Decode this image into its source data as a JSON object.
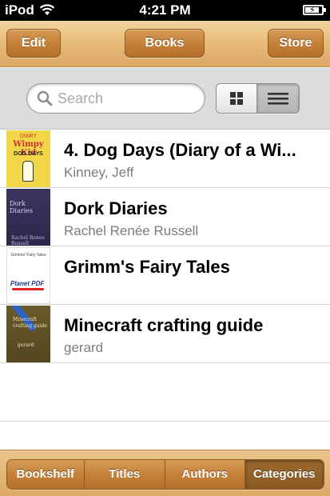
{
  "status_bar": {
    "carrier": "iPod",
    "time": "4:21 PM",
    "wifi_icon": "wifi-icon",
    "battery_icon": "battery-charging-icon"
  },
  "toolbar": {
    "edit_label": "Edit",
    "books_label": "Books",
    "store_label": "Store"
  },
  "search": {
    "placeholder": "Search",
    "value": "",
    "icon": "search-icon"
  },
  "view_toggle": {
    "options": [
      "grid-view-icon",
      "list-view-icon"
    ],
    "selected": "list"
  },
  "books": [
    {
      "title": "4. Dog Days (Diary of a Wi...",
      "author": "Kinney, Jeff",
      "cover": {
        "line1": "DIARY",
        "line2": "Wimpy Kid",
        "line3": "DOG DAYS",
        "color": "#f2d64a"
      }
    },
    {
      "title": "Dork Diaries",
      "author": "Rachel Renée Russell",
      "cover": {
        "line1": "Dork Diaries",
        "line2": "Rachel Renee Russell",
        "color": "#2c284a"
      }
    },
    {
      "title": "Grimm's Fairy Tales",
      "author": "",
      "cover": {
        "line1": "Grimms' Fairy Tales",
        "line2": "Planet PDF",
        "color": "#ffffff"
      }
    },
    {
      "title": "Minecraft crafting guide",
      "author": "gerard",
      "cover": {
        "line1": "Minecraft crafting guide",
        "line2": "gerard",
        "color": "#5f5026"
      }
    }
  ],
  "tabs": [
    {
      "label": "Bookshelf"
    },
    {
      "label": "Titles"
    },
    {
      "label": "Authors"
    },
    {
      "label": "Categories",
      "active": true
    }
  ],
  "colors": {
    "wood_button": "#c47f38",
    "wood_bar": "#e7bb78",
    "search_bg": "#dcdcdc",
    "author_text": "#7c7c7c"
  }
}
